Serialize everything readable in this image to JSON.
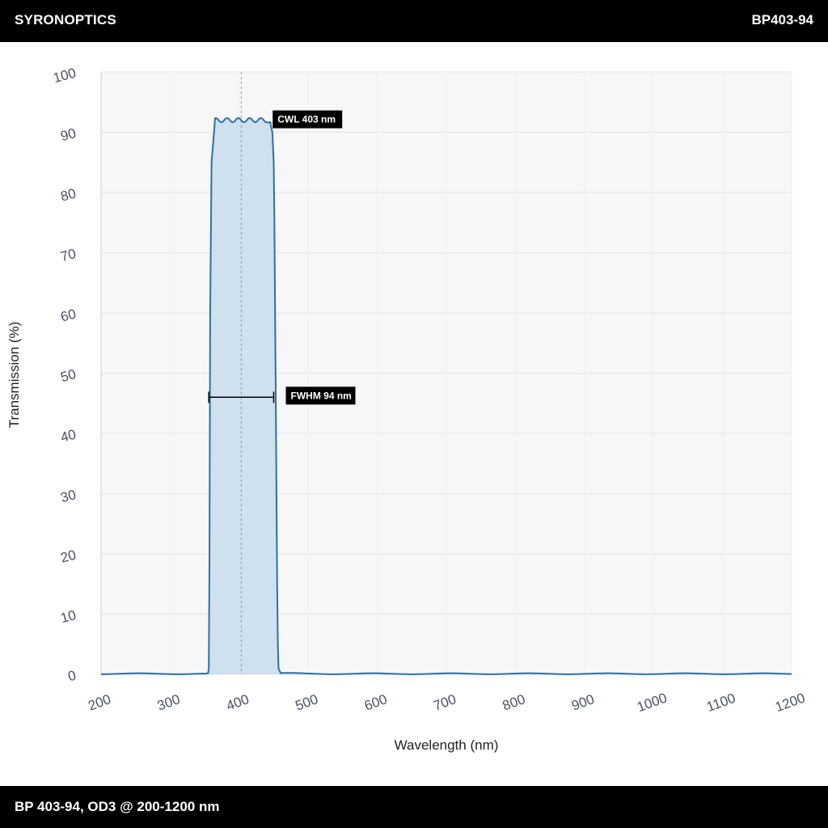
{
  "header": {
    "brand": "SYRONOPTICS",
    "model": "BP403-94"
  },
  "footer": {
    "caption": "BP 403-94, OD3 @ 200-1200 nm"
  },
  "colors": {
    "line": "#2f6fa8",
    "fill": "#cfe0ee",
    "plot_bg": "#f7f7f7",
    "grid": "#e4e4e4",
    "bars": "#000000"
  },
  "chart_data": {
    "type": "area",
    "title": "",
    "xlabel": "Wavelength (nm)",
    "ylabel": "Transmission (%)",
    "xlim": [
      200,
      1200
    ],
    "ylim": [
      0,
      100
    ],
    "x_ticks": [
      200,
      300,
      400,
      500,
      600,
      700,
      800,
      900,
      1000,
      1100,
      1200
    ],
    "y_ticks": [
      0,
      10,
      20,
      30,
      40,
      50,
      60,
      70,
      80,
      90,
      100
    ],
    "grid": true,
    "series": [
      {
        "x": [
          200,
          300,
          350,
          355,
          356,
          357,
          358,
          360,
          365,
          370,
          380,
          390,
          400,
          410,
          420,
          430,
          440,
          445,
          448,
          450,
          451,
          452,
          453,
          454,
          455,
          456,
          457,
          460,
          500,
          600,
          700,
          800,
          900,
          1000,
          1100,
          1200
        ],
        "y": [
          0.1,
          0.1,
          0.1,
          0.2,
          1,
          20,
          60,
          85,
          92,
          92,
          92,
          92,
          92,
          92,
          92,
          92,
          92,
          91.5,
          90,
          85,
          75,
          60,
          46,
          30,
          15,
          5,
          1,
          0.2,
          0.1,
          0.1,
          0.1,
          0.1,
          0.1,
          0.1,
          0.1,
          0.1
        ]
      }
    ],
    "annotations": {
      "cwl": {
        "label": "CWL 403 nm",
        "x": 403
      },
      "fwhm": {
        "label": "FWHM 94 nm",
        "x_start": 356,
        "x_end": 450,
        "y": 46
      }
    }
  }
}
